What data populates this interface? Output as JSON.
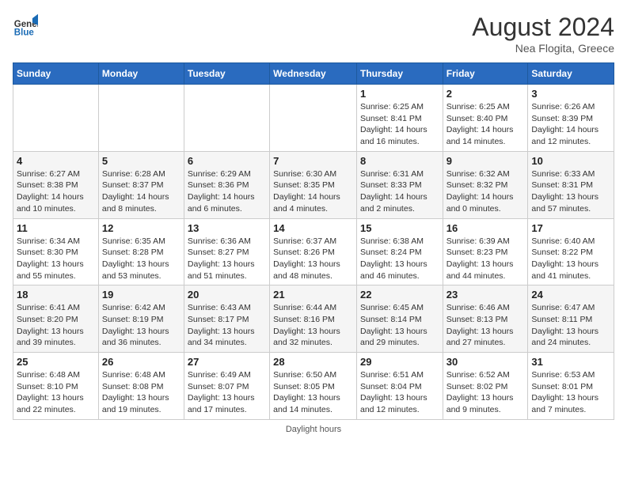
{
  "logo": {
    "line1": "General",
    "line2": "Blue"
  },
  "title": "August 2024",
  "subtitle": "Nea Flogita, Greece",
  "days_of_week": [
    "Sunday",
    "Monday",
    "Tuesday",
    "Wednesday",
    "Thursday",
    "Friday",
    "Saturday"
  ],
  "footer": "Daylight hours",
  "weeks": [
    [
      {
        "num": "",
        "info": ""
      },
      {
        "num": "",
        "info": ""
      },
      {
        "num": "",
        "info": ""
      },
      {
        "num": "",
        "info": ""
      },
      {
        "num": "1",
        "info": "Sunrise: 6:25 AM\nSunset: 8:41 PM\nDaylight: 14 hours and 16 minutes."
      },
      {
        "num": "2",
        "info": "Sunrise: 6:25 AM\nSunset: 8:40 PM\nDaylight: 14 hours and 14 minutes."
      },
      {
        "num": "3",
        "info": "Sunrise: 6:26 AM\nSunset: 8:39 PM\nDaylight: 14 hours and 12 minutes."
      }
    ],
    [
      {
        "num": "4",
        "info": "Sunrise: 6:27 AM\nSunset: 8:38 PM\nDaylight: 14 hours and 10 minutes."
      },
      {
        "num": "5",
        "info": "Sunrise: 6:28 AM\nSunset: 8:37 PM\nDaylight: 14 hours and 8 minutes."
      },
      {
        "num": "6",
        "info": "Sunrise: 6:29 AM\nSunset: 8:36 PM\nDaylight: 14 hours and 6 minutes."
      },
      {
        "num": "7",
        "info": "Sunrise: 6:30 AM\nSunset: 8:35 PM\nDaylight: 14 hours and 4 minutes."
      },
      {
        "num": "8",
        "info": "Sunrise: 6:31 AM\nSunset: 8:33 PM\nDaylight: 14 hours and 2 minutes."
      },
      {
        "num": "9",
        "info": "Sunrise: 6:32 AM\nSunset: 8:32 PM\nDaylight: 14 hours and 0 minutes."
      },
      {
        "num": "10",
        "info": "Sunrise: 6:33 AM\nSunset: 8:31 PM\nDaylight: 13 hours and 57 minutes."
      }
    ],
    [
      {
        "num": "11",
        "info": "Sunrise: 6:34 AM\nSunset: 8:30 PM\nDaylight: 13 hours and 55 minutes."
      },
      {
        "num": "12",
        "info": "Sunrise: 6:35 AM\nSunset: 8:28 PM\nDaylight: 13 hours and 53 minutes."
      },
      {
        "num": "13",
        "info": "Sunrise: 6:36 AM\nSunset: 8:27 PM\nDaylight: 13 hours and 51 minutes."
      },
      {
        "num": "14",
        "info": "Sunrise: 6:37 AM\nSunset: 8:26 PM\nDaylight: 13 hours and 48 minutes."
      },
      {
        "num": "15",
        "info": "Sunrise: 6:38 AM\nSunset: 8:24 PM\nDaylight: 13 hours and 46 minutes."
      },
      {
        "num": "16",
        "info": "Sunrise: 6:39 AM\nSunset: 8:23 PM\nDaylight: 13 hours and 44 minutes."
      },
      {
        "num": "17",
        "info": "Sunrise: 6:40 AM\nSunset: 8:22 PM\nDaylight: 13 hours and 41 minutes."
      }
    ],
    [
      {
        "num": "18",
        "info": "Sunrise: 6:41 AM\nSunset: 8:20 PM\nDaylight: 13 hours and 39 minutes."
      },
      {
        "num": "19",
        "info": "Sunrise: 6:42 AM\nSunset: 8:19 PM\nDaylight: 13 hours and 36 minutes."
      },
      {
        "num": "20",
        "info": "Sunrise: 6:43 AM\nSunset: 8:17 PM\nDaylight: 13 hours and 34 minutes."
      },
      {
        "num": "21",
        "info": "Sunrise: 6:44 AM\nSunset: 8:16 PM\nDaylight: 13 hours and 32 minutes."
      },
      {
        "num": "22",
        "info": "Sunrise: 6:45 AM\nSunset: 8:14 PM\nDaylight: 13 hours and 29 minutes."
      },
      {
        "num": "23",
        "info": "Sunrise: 6:46 AM\nSunset: 8:13 PM\nDaylight: 13 hours and 27 minutes."
      },
      {
        "num": "24",
        "info": "Sunrise: 6:47 AM\nSunset: 8:11 PM\nDaylight: 13 hours and 24 minutes."
      }
    ],
    [
      {
        "num": "25",
        "info": "Sunrise: 6:48 AM\nSunset: 8:10 PM\nDaylight: 13 hours and 22 minutes."
      },
      {
        "num": "26",
        "info": "Sunrise: 6:48 AM\nSunset: 8:08 PM\nDaylight: 13 hours and 19 minutes."
      },
      {
        "num": "27",
        "info": "Sunrise: 6:49 AM\nSunset: 8:07 PM\nDaylight: 13 hours and 17 minutes."
      },
      {
        "num": "28",
        "info": "Sunrise: 6:50 AM\nSunset: 8:05 PM\nDaylight: 13 hours and 14 minutes."
      },
      {
        "num": "29",
        "info": "Sunrise: 6:51 AM\nSunset: 8:04 PM\nDaylight: 13 hours and 12 minutes."
      },
      {
        "num": "30",
        "info": "Sunrise: 6:52 AM\nSunset: 8:02 PM\nDaylight: 13 hours and 9 minutes."
      },
      {
        "num": "31",
        "info": "Sunrise: 6:53 AM\nSunset: 8:01 PM\nDaylight: 13 hours and 7 minutes."
      }
    ]
  ]
}
